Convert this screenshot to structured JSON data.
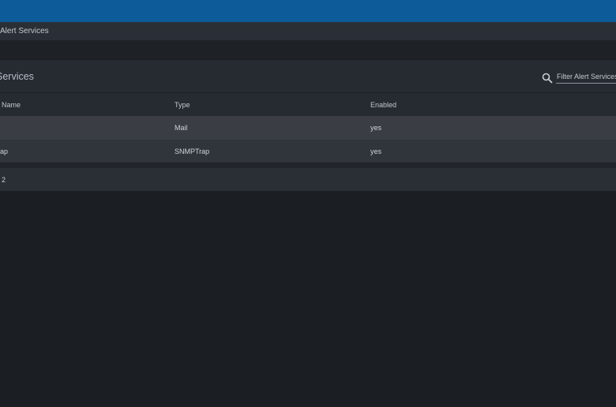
{
  "header": {
    "breadcrumb": "Alert Services"
  },
  "panel": {
    "title": "Services",
    "search": {
      "placeholder": "Filter Alert Services",
      "value": ""
    }
  },
  "table": {
    "columns": [
      "Name",
      "Type",
      "Enabled"
    ],
    "rows": [
      {
        "name": "",
        "type": "Mail",
        "enabled": "yes"
      },
      {
        "name": "rap",
        "type": "SNMPTrap",
        "enabled": "yes"
      }
    ],
    "total": "2"
  },
  "colors": {
    "top_bar": "#0e5b99",
    "background": "#1b1e23",
    "panel": "#262b32",
    "row_highlight": "#3a3e44"
  }
}
